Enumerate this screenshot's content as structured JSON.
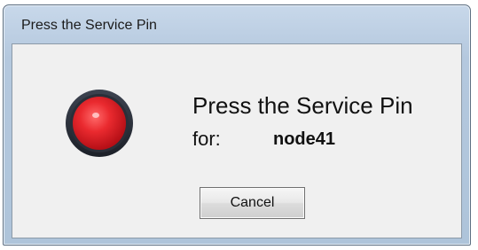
{
  "dialog": {
    "title": "Press the Service Pin",
    "message": "Press the Service Pin",
    "for_label": "for:",
    "node_name": "node41",
    "cancel_label": "Cancel"
  },
  "indicator": {
    "icon": "red-indicator-light-icon",
    "color": "#e0262b"
  }
}
